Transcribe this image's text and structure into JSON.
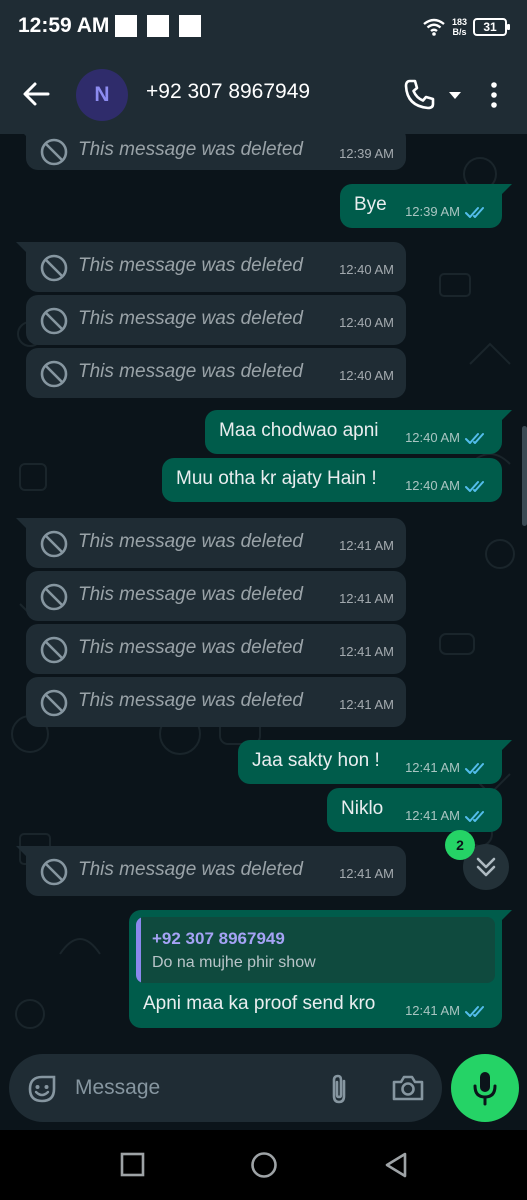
{
  "status": {
    "time": "12:59 AM",
    "net_speed_value": "183",
    "net_speed_unit": "B/s",
    "battery": "31"
  },
  "contact": {
    "avatar_initial": "N",
    "name": "+92 307 8967949"
  },
  "messages": [
    {
      "dir": "in",
      "deleted": true,
      "text": "This message was deleted",
      "time": "12:39 AM"
    },
    {
      "dir": "out",
      "text": "Bye",
      "time": "12:39 AM",
      "status": "read"
    },
    {
      "dir": "in",
      "deleted": true,
      "text": "This message was deleted",
      "time": "12:40 AM"
    },
    {
      "dir": "in",
      "deleted": true,
      "text": "This message was deleted",
      "time": "12:40 AM"
    },
    {
      "dir": "in",
      "deleted": true,
      "text": "This message was deleted",
      "time": "12:40 AM"
    },
    {
      "dir": "out",
      "text": "Maa chodwao apni",
      "time": "12:40 AM",
      "status": "read"
    },
    {
      "dir": "out",
      "text": "Muu otha kr ajaty Hain !",
      "time": "12:40 AM",
      "status": "read"
    },
    {
      "dir": "in",
      "deleted": true,
      "text": "This message was deleted",
      "time": "12:41 AM"
    },
    {
      "dir": "in",
      "deleted": true,
      "text": "This message was deleted",
      "time": "12:41 AM"
    },
    {
      "dir": "in",
      "deleted": true,
      "text": "This message was deleted",
      "time": "12:41 AM"
    },
    {
      "dir": "in",
      "deleted": true,
      "text": "This message was deleted",
      "time": "12:41 AM"
    },
    {
      "dir": "out",
      "text": "Jaa sakty hon !",
      "time": "12:41 AM",
      "status": "read"
    },
    {
      "dir": "out",
      "text": "Niklo",
      "time": "12:41 AM",
      "status": "read"
    },
    {
      "dir": "in",
      "deleted": true,
      "text": "This message was deleted",
      "time": "12:41 AM"
    },
    {
      "dir": "out",
      "text": "Apni maa ka proof send kro",
      "time": "12:41 AM",
      "status": "read",
      "reply": {
        "name": "+92 307 8967949",
        "text": "Do na mujhe phir show"
      }
    }
  ],
  "unread_count": "2",
  "composer": {
    "placeholder": "Message"
  },
  "icons": {
    "back": "arrow-left-icon",
    "call": "phone-icon",
    "call_menu": "caret-down-icon",
    "more": "more-vert-icon",
    "deleted": "ban-icon",
    "read": "double-check-icon",
    "emoji": "sticker-icon",
    "attach": "paperclip-icon",
    "camera": "camera-icon",
    "mic": "mic-icon",
    "scroll_down": "double-chevron-down-icon"
  },
  "colors": {
    "background": "#0b141a",
    "header": "#1f2c34",
    "incoming_bubble": "#1f2c34",
    "outgoing_bubble": "#005c4b",
    "accent_green": "#25d366",
    "read_tick": "#53bdeb"
  }
}
